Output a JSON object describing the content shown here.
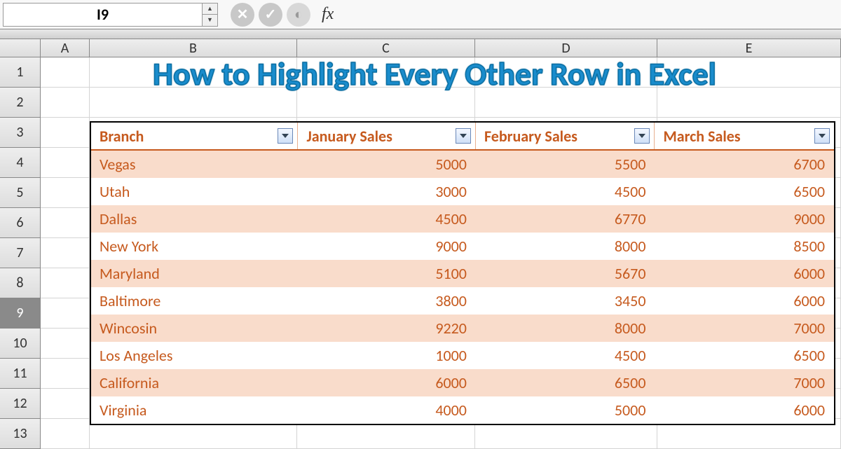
{
  "formula_bar": {
    "name_box": "I9",
    "fx_label": "fx"
  },
  "columns": [
    "A",
    "B",
    "C",
    "D",
    "E"
  ],
  "row_numbers": [
    "1",
    "2",
    "3",
    "4",
    "5",
    "6",
    "7",
    "8",
    "9",
    "10",
    "11",
    "12",
    "13"
  ],
  "active_row": "9",
  "overlay_title": "How to Highlight Every Other Row in Excel",
  "table": {
    "headers": [
      "Branch",
      "January Sales",
      "February Sales",
      "March Sales"
    ],
    "rows": [
      {
        "branch": "Vegas",
        "jan": "5000",
        "feb": "5500",
        "mar": "6700"
      },
      {
        "branch": "Utah",
        "jan": "3000",
        "feb": "4500",
        "mar": "6500"
      },
      {
        "branch": "Dallas",
        "jan": "4500",
        "feb": "6770",
        "mar": "9000"
      },
      {
        "branch": "New York",
        "jan": "9000",
        "feb": "8000",
        "mar": "8500"
      },
      {
        "branch": "Maryland",
        "jan": "5100",
        "feb": "5670",
        "mar": "6000"
      },
      {
        "branch": "Baltimore",
        "jan": "3800",
        "feb": "3450",
        "mar": "6000"
      },
      {
        "branch": "Wincosin",
        "jan": "9220",
        "feb": "8000",
        "mar": "7000"
      },
      {
        "branch": "Los Angeles",
        "jan": "1000",
        "feb": "4500",
        "mar": "6500"
      },
      {
        "branch": "California",
        "jan": "6000",
        "feb": "6500",
        "mar": "7000"
      },
      {
        "branch": "Virginia",
        "jan": "4000",
        "feb": "5000",
        "mar": "6000"
      }
    ]
  },
  "chart_data": {
    "type": "table",
    "title": "How to Highlight Every Other Row in Excel",
    "columns": [
      "Branch",
      "January Sales",
      "February Sales",
      "March Sales"
    ],
    "rows": [
      [
        "Vegas",
        5000,
        5500,
        6700
      ],
      [
        "Utah",
        3000,
        4500,
        6500
      ],
      [
        "Dallas",
        4500,
        6770,
        9000
      ],
      [
        "New York",
        9000,
        8000,
        8500
      ],
      [
        "Maryland",
        5100,
        5670,
        6000
      ],
      [
        "Baltimore",
        3800,
        3450,
        6000
      ],
      [
        "Wincosin",
        9220,
        8000,
        7000
      ],
      [
        "Los Angeles",
        1000,
        4500,
        6500
      ],
      [
        "California",
        6000,
        6500,
        7000
      ],
      [
        "Virginia",
        4000,
        5000,
        6000
      ]
    ]
  }
}
